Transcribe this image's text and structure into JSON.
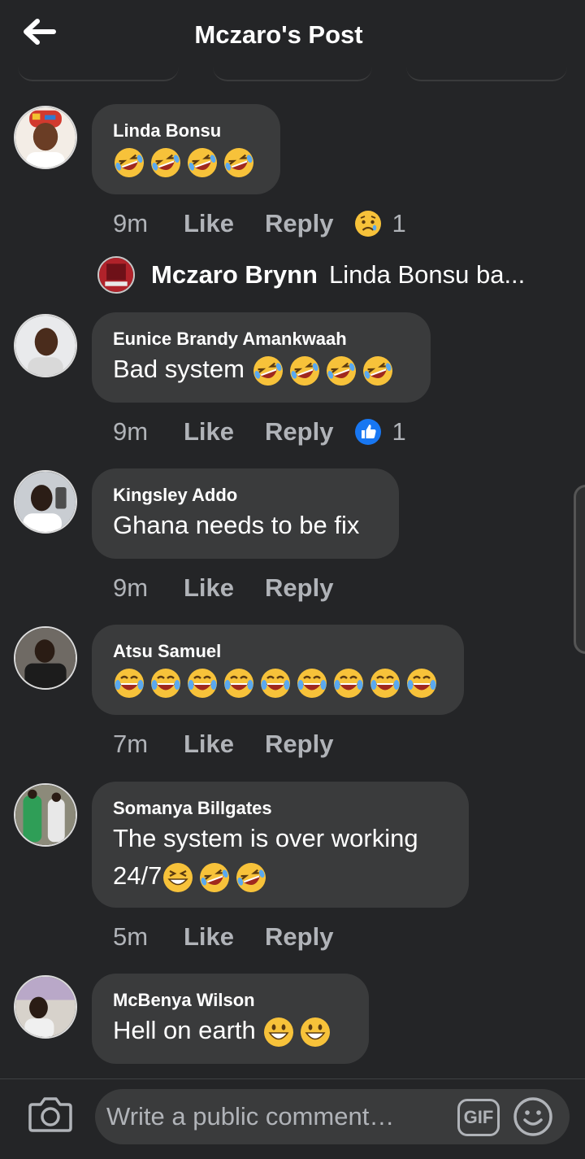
{
  "header": {
    "title": "Mczaro's Post",
    "back_icon": "arrow-left-icon"
  },
  "colors": {
    "background": "#242527",
    "bubble": "#3a3b3c",
    "muted": "#b0b3b8",
    "text": "#ffffff",
    "like_blue": "#1877f2",
    "emoji_yellow": "#f7c23a"
  },
  "comments": [
    {
      "author": "Linda Bonsu",
      "text": "",
      "emojis": [
        "rofl-emoji",
        "rofl-emoji",
        "rofl-emoji",
        "rofl-emoji"
      ],
      "time": "9m",
      "like": "Like",
      "reply": "Reply",
      "reaction": "sad-reaction-icon",
      "reaction_count": "1"
    },
    {
      "author": "Eunice Brandy Amankwaah",
      "text": "Bad system",
      "emojis": [
        "rofl-emoji",
        "rofl-emoji",
        "rofl-emoji",
        "rofl-emoji"
      ],
      "time": "9m",
      "like": "Like",
      "reply": "Reply",
      "reaction": "like-reaction-icon",
      "reaction_count": "1"
    },
    {
      "author": "Kingsley Addo",
      "text": "Ghana needs to be fix",
      "emojis": [],
      "time": "9m",
      "like": "Like",
      "reply": "Reply"
    },
    {
      "author": "Atsu Samuel",
      "text": "",
      "emojis": [
        "laughing-tears-emoji",
        "laughing-tears-emoji",
        "laughing-tears-emoji",
        "laughing-tears-emoji",
        "laughing-tears-emoji",
        "laughing-tears-emoji",
        "laughing-tears-emoji",
        "laughing-tears-emoji",
        "laughing-tears-emoji"
      ],
      "time": "7m",
      "like": "Like",
      "reply": "Reply"
    },
    {
      "author": "Somanya Billgates",
      "text": "The system is over working",
      "text_line2": "24/7",
      "emojis": [
        "grinning-squint-emoji",
        "rofl-emoji",
        "rofl-emoji"
      ],
      "time": "5m",
      "like": "Like",
      "reply": "Reply"
    },
    {
      "author": "McBenya Wilson",
      "text": "Hell on earth",
      "emojis": [
        "grinning-emoji",
        "grinning-emoji"
      ]
    }
  ],
  "reply_preview": {
    "author": "Mczaro Brynn",
    "snippet": "Linda Bonsu ba..."
  },
  "composer": {
    "placeholder": "Write a public comment…",
    "gif_label": "GIF",
    "camera_icon": "camera-icon",
    "emoji_icon": "smiley-icon"
  }
}
